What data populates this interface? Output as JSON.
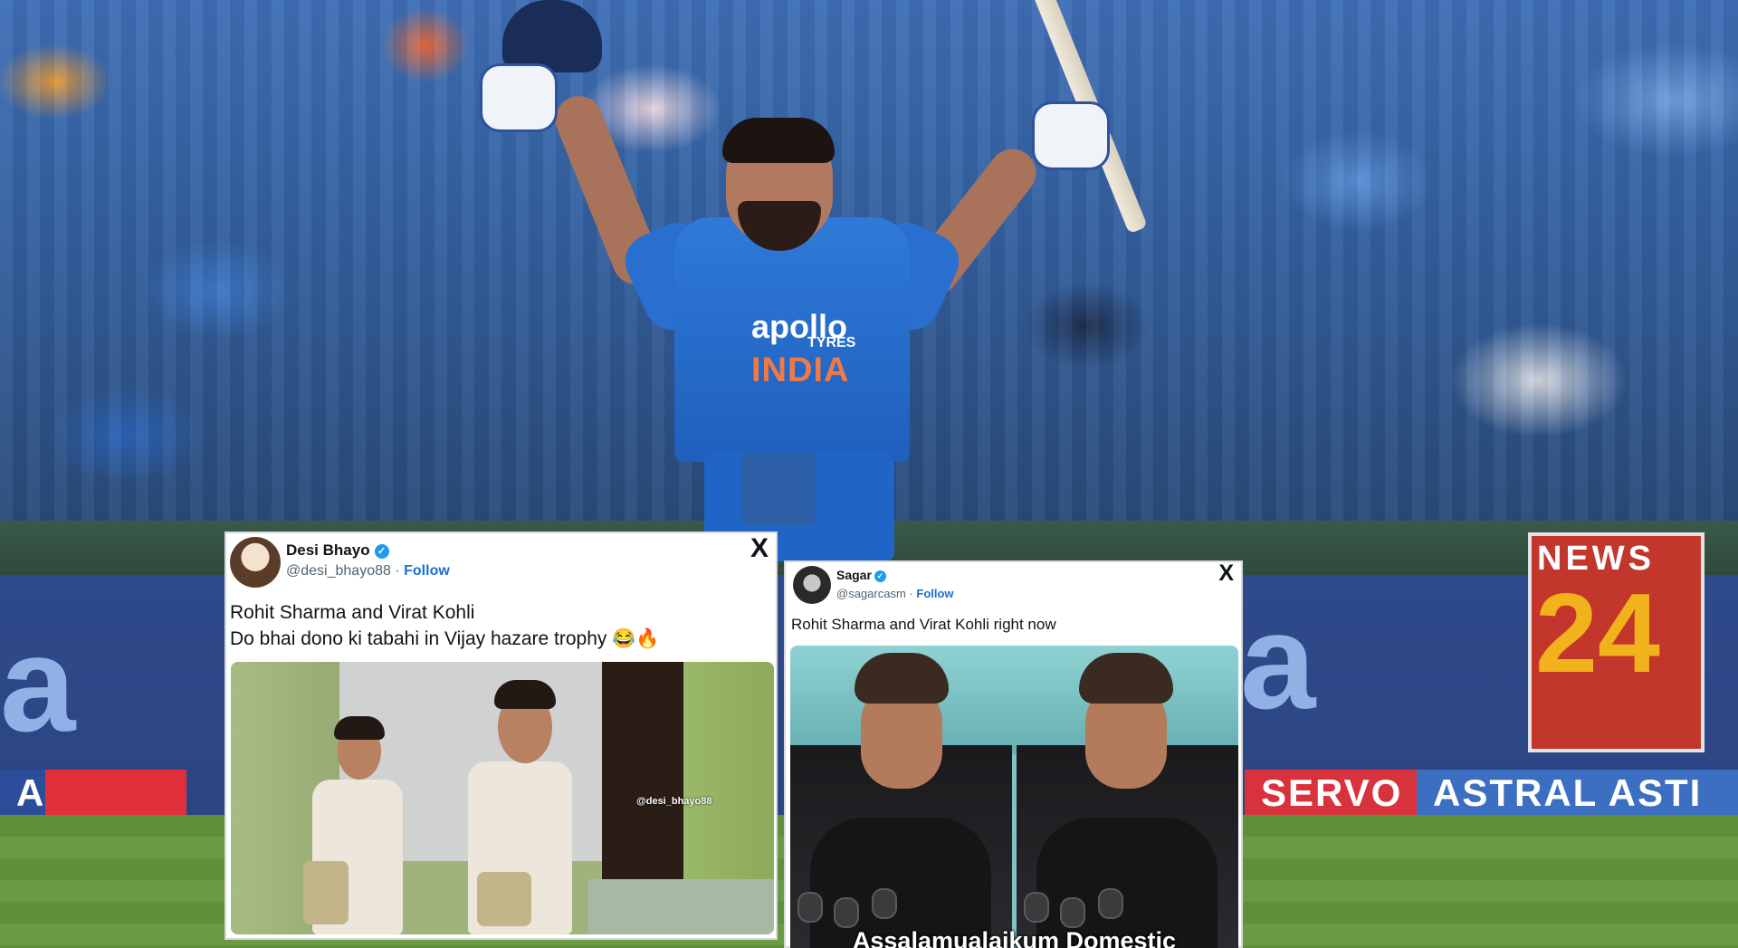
{
  "background": {
    "jersey_sponsor": "apollo",
    "jersey_sponsor_sub": "TYRES",
    "jersey_team": "INDIA",
    "board_letter_left": "a",
    "board_letter_right": "a",
    "strip_left": "AL",
    "strip_right_red": "SERVO",
    "strip_right_blue": "ASTRAL ASTI",
    "news_title": "NEWS",
    "news_number": "24",
    "colors": {
      "crowd_blue": "#3f6fb6",
      "ad_board": "#2f4a8a",
      "news_red": "#c2362c",
      "news_gold": "#f2b21b",
      "field_green": "#5f8f3b"
    }
  },
  "tweets": [
    {
      "name": "Desi Bhayo",
      "verified_icon": "verified-badge-icon",
      "handle": "@desi_bhayo88",
      "separator": "·",
      "follow_label": "Follow",
      "close_label": "X",
      "text_line_1": "Rohit Sharma and Virat Kohli",
      "text_line_2": "Do bhai dono ki tabahi in Vijay hazare trophy 😂🔥",
      "media_watermark": "@desi_bhayo88"
    },
    {
      "name": "Sagar",
      "verified_icon": "verified-badge-icon",
      "handle": "@sagarcasm",
      "separator": "·",
      "follow_label": "Follow",
      "close_label": "X",
      "text_line_1": "Rohit Sharma and Virat Kohli right now",
      "media_caption": "Assalamualaikum Domestic"
    }
  ]
}
